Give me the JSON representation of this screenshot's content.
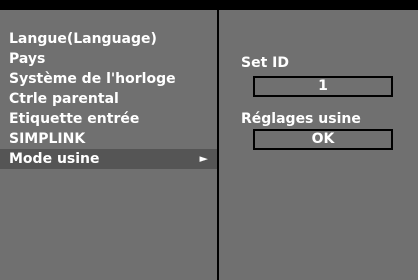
{
  "menu": {
    "items": [
      {
        "label": "Langue(Language)"
      },
      {
        "label": "Pays"
      },
      {
        "label": "Système de l'horloge"
      },
      {
        "label": "Ctrle parental"
      },
      {
        "label": "Etiquette entrée"
      },
      {
        "label": "SIMPLINK"
      },
      {
        "label": "Mode usine",
        "arrow": "►",
        "selected": true
      }
    ]
  },
  "detail": {
    "set_id_label": "Set ID",
    "set_id_value": "1",
    "reset_label": "Réglages usine",
    "reset_button": "OK"
  },
  "colors": {
    "background": "#000000",
    "panel": "#707070",
    "highlight": "#555555",
    "text": "#ffffff"
  },
  "icons": {
    "submenu_arrow": "right-triangle-icon"
  }
}
